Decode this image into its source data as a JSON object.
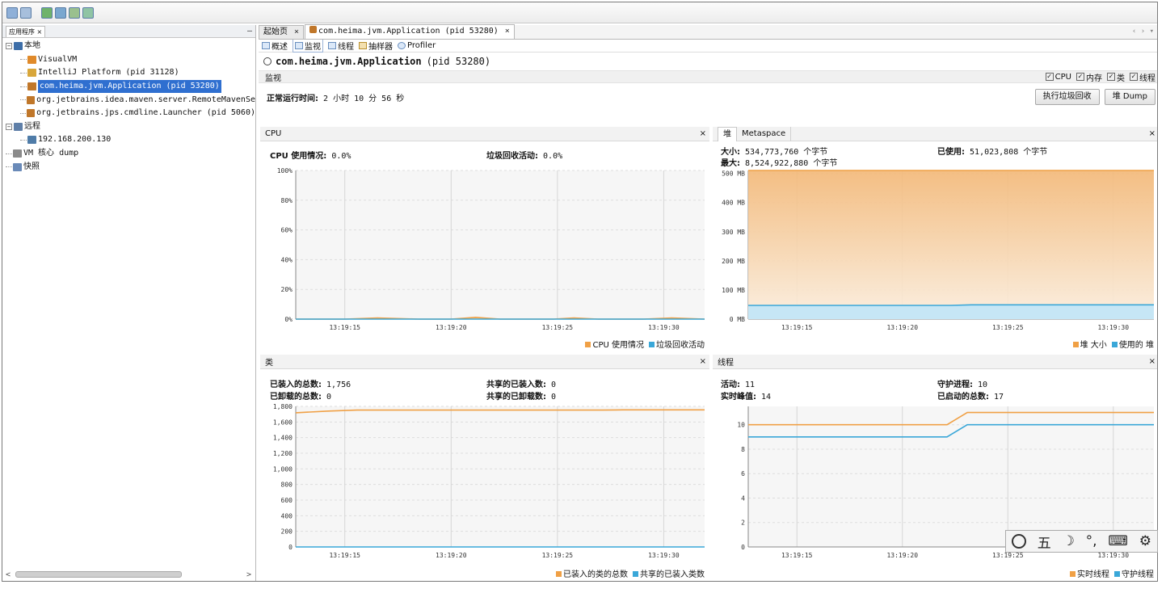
{
  "left_panel": {
    "tab_label": "应用程序 ×",
    "minimize": "—",
    "tree": [
      {
        "label": "本地",
        "expander": "−",
        "indent": 0,
        "icon": "local-host-icon",
        "color": "#3d6ea8"
      },
      {
        "label": "VisualVM",
        "indent": 1,
        "icon": "visualvm-icon",
        "color": "#e08a2a"
      },
      {
        "label": "IntelliJ Platform (pid 31128)",
        "indent": 1,
        "icon": "intellij-icon",
        "color": "#d8a63a"
      },
      {
        "label": "com.heima.jvm.Application (pid 53280)",
        "indent": 1,
        "icon": "java-app-icon",
        "color": "#c0772a",
        "selected": true
      },
      {
        "label": "org.jetbrains.idea.maven.server.RemoteMavenSe",
        "indent": 1,
        "icon": "java-app-icon",
        "color": "#c0772a"
      },
      {
        "label": "org.jetbrains.jps.cmdline.Launcher (pid 5060)",
        "indent": 1,
        "icon": "java-app-icon",
        "color": "#c0772a"
      },
      {
        "label": "远程",
        "expander": "−",
        "indent": 0,
        "icon": "remote-icon",
        "color": "#5f7fa8"
      },
      {
        "label": "192.168.200.130",
        "indent": 1,
        "icon": "remote-host-icon",
        "color": "#4f7ca8"
      },
      {
        "label": "VM 核心 dump",
        "indent": 0,
        "icon": "core-dump-icon",
        "color": "#8a8a8a"
      },
      {
        "label": "快照",
        "indent": 0,
        "icon": "snapshot-icon",
        "color": "#6a8ab8"
      }
    ],
    "scroll_left": "<",
    "scroll_right": ">"
  },
  "doc_tabs": [
    {
      "label": "起始页",
      "close": "×",
      "active": false
    },
    {
      "label": "com.heima.jvm.Application (pid 53280)",
      "close": "×",
      "active": true
    }
  ],
  "doc_nav": "‹ › ▾",
  "sub_tabs": [
    {
      "label": "概述",
      "active": false
    },
    {
      "label": "监视",
      "active": true
    },
    {
      "label": "线程",
      "active": false
    },
    {
      "label": "抽样器",
      "active": false
    },
    {
      "label": "Profiler",
      "active": false
    }
  ],
  "app_title": {
    "name": "com.heima.jvm.Application",
    "pid": "(pid 53280)"
  },
  "monitor_label": "监视",
  "checkboxes": [
    {
      "label": "CPU",
      "checked": true
    },
    {
      "label": "内存",
      "checked": true
    },
    {
      "label": "类",
      "checked": true
    },
    {
      "label": "线程",
      "checked": true
    }
  ],
  "uptime": {
    "label": "正常运行时间:",
    "value": "2 小时 10 分 56 秒"
  },
  "buttons": {
    "gc": "执行垃圾回收",
    "heap_dump": "堆 Dump"
  },
  "cpu_panel": {
    "title": "CPU",
    "close": "×",
    "stats": [
      {
        "label": "CPU 使用情况:",
        "value": "0.0%"
      },
      {
        "label": "垃圾回收活动:",
        "value": "0.0%"
      }
    ],
    "legend": [
      "CPU 使用情况",
      "垃圾回收活动"
    ]
  },
  "heap_panel": {
    "tabs": [
      "堆",
      "Metaspace"
    ],
    "close": "×",
    "stats": [
      {
        "label": "大小:",
        "value": "534,773,760 个字节"
      },
      {
        "label": "已使用:",
        "value": "51,023,808 个字节"
      },
      {
        "label": "最大:",
        "value": "8,524,922,880 个字节"
      }
    ],
    "legend": [
      "堆 大小",
      "使用的 堆"
    ]
  },
  "classes_panel": {
    "title": "类",
    "close": "×",
    "stats": [
      {
        "label": "已装入的总数:",
        "value": "1,756"
      },
      {
        "label": "共享的已装入数:",
        "value": "0"
      },
      {
        "label": "已卸载的总数:",
        "value": "0"
      },
      {
        "label": "共享的已卸载数:",
        "value": "0"
      }
    ],
    "legend": [
      "已装入的类的总数",
      "共享的已装入类数"
    ]
  },
  "threads_panel": {
    "title": "线程",
    "close": "×",
    "stats": [
      {
        "label": "活动:",
        "value": "11"
      },
      {
        "label": "守护进程:",
        "value": "10"
      },
      {
        "label": "实时峰值:",
        "value": "14"
      },
      {
        "label": "已启动的总数:",
        "value": "17"
      }
    ],
    "legend": [
      "实时线程",
      "守护线程"
    ]
  },
  "ime_toolbar": {
    "mode": "五",
    "moon": "☽",
    "punct": "°,",
    "keyboard": "⌨",
    "settings": "⚙"
  },
  "colors": {
    "orange": "#f0a045",
    "blue": "#3aa7d8",
    "heap_fill": "#f6cf9f",
    "used_fill": "#c6e6f5",
    "selection": "#2f6fd0"
  },
  "chart_data": [
    {
      "type": "area",
      "title": "CPU",
      "x": [
        "13:19:15",
        "13:19:20",
        "13:19:25",
        "13:19:30"
      ],
      "yticks": [
        "0%",
        "20%",
        "40%",
        "60%",
        "80%",
        "100%"
      ],
      "ylim": [
        0,
        100
      ],
      "series": [
        {
          "name": "CPU 使用情况",
          "color": "#f0a045",
          "points": [
            [
              0,
              0
            ],
            [
              0.12,
              0
            ],
            [
              0.2,
              0.8
            ],
            [
              0.3,
              0
            ],
            [
              0.38,
              0
            ],
            [
              0.44,
              1.2
            ],
            [
              0.5,
              0
            ],
            [
              0.63,
              0
            ],
            [
              0.68,
              0.8
            ],
            [
              0.74,
              0
            ],
            [
              0.85,
              0
            ],
            [
              0.92,
              0.8
            ],
            [
              1,
              0
            ]
          ]
        },
        {
          "name": "垃圾回收活动",
          "color": "#3aa7d8",
          "points": [
            [
              0,
              0
            ],
            [
              1,
              0
            ]
          ]
        }
      ]
    },
    {
      "type": "area",
      "title": "堆",
      "x": [
        "13:19:15",
        "13:19:20",
        "13:19:25",
        "13:19:30"
      ],
      "yticks": [
        "0 MB",
        "100 MB",
        "200 MB",
        "300 MB",
        "400 MB",
        "500 MB"
      ],
      "ylim": [
        0,
        510
      ],
      "series": [
        {
          "name": "堆 大小",
          "color": "#f0a045",
          "points": [
            [
              0,
              510
            ],
            [
              1,
              510
            ]
          ]
        },
        {
          "name": "使用的 堆",
          "color": "#3aa7d8",
          "points": [
            [
              0,
              47
            ],
            [
              0.5,
              47
            ],
            [
              0.55,
              49
            ],
            [
              1,
              49
            ]
          ]
        }
      ]
    },
    {
      "type": "line",
      "title": "类",
      "x": [
        "13:19:15",
        "13:19:20",
        "13:19:25",
        "13:19:30"
      ],
      "yticks": [
        "0",
        "200",
        "400",
        "600",
        "800",
        "1,000",
        "1,200",
        "1,400",
        "1,600",
        "1,800"
      ],
      "ylim": [
        0,
        1800
      ],
      "series": [
        {
          "name": "已装入的类的总数",
          "color": "#f0a045",
          "points": [
            [
              0,
              1718
            ],
            [
              0.08,
              1740
            ],
            [
              0.15,
              1752
            ],
            [
              0.75,
              1752
            ],
            [
              0.8,
              1756
            ],
            [
              1,
              1756
            ]
          ]
        },
        {
          "name": "共享的已装入类数",
          "color": "#3aa7d8",
          "points": [
            [
              0,
              0
            ],
            [
              1,
              0
            ]
          ]
        }
      ]
    },
    {
      "type": "line",
      "title": "线程",
      "x": [
        "13:19:15",
        "13:19:20",
        "13:19:25",
        "13:19:30"
      ],
      "yticks": [
        "0",
        "2",
        "4",
        "6",
        "8",
        "10"
      ],
      "ylim": [
        0,
        11.5
      ],
      "series": [
        {
          "name": "实时线程",
          "color": "#f0a045",
          "points": [
            [
              0,
              10
            ],
            [
              0.49,
              10
            ],
            [
              0.54,
              11
            ],
            [
              1,
              11
            ]
          ]
        },
        {
          "name": "守护线程",
          "color": "#3aa7d8",
          "points": [
            [
              0,
              9
            ],
            [
              0.49,
              9
            ],
            [
              0.54,
              10
            ],
            [
              1,
              10
            ]
          ]
        }
      ]
    }
  ]
}
